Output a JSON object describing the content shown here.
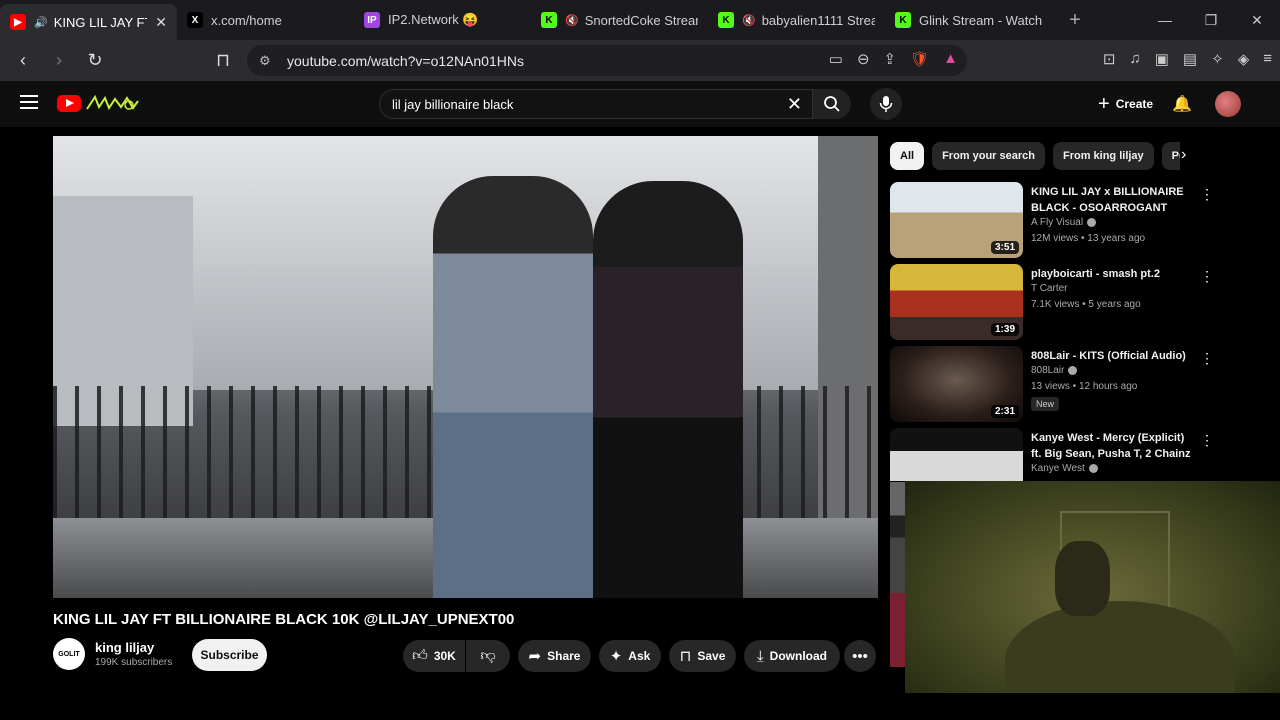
{
  "browser": {
    "tabs": [
      {
        "label": "KING LIL JAY FT B",
        "favicon": "youtube-icon",
        "color": "#ff0000",
        "muted": true,
        "active": true
      },
      {
        "label": "x.com/home",
        "favicon": "x-icon",
        "color": "#000000",
        "muted": false
      },
      {
        "label": "IP2.Network 😝",
        "favicon": "ip2-icon",
        "color": "#a045e0",
        "muted": false
      },
      {
        "label": "SnortedCoke Stream",
        "favicon": "kick-icon",
        "color": "#53fc18",
        "muted": true
      },
      {
        "label": "babyalien1111 Strea",
        "favicon": "kick-icon",
        "color": "#53fc18",
        "muted": true
      },
      {
        "label": "Glink Stream - Watch Li",
        "favicon": "kick-icon",
        "color": "#53fc18",
        "muted": false
      }
    ],
    "url": "youtube.com/watch?v=o12NAn01HNs",
    "badge_count": "99+"
  },
  "youtube": {
    "search_query": "lil jay billionaire black",
    "create_label": "Create",
    "video": {
      "title": "KING LIL JAY FT BILLIONAIRE BLACK 10K @LILJAY_UPNEXT00",
      "channel": "king liljay",
      "subscribers": "199K subscribers",
      "subscribe_label": "Subscribe",
      "likes": "30K",
      "share_label": "Share",
      "ask_label": "Ask",
      "save_label": "Save",
      "download_label": "Download",
      "channel_avatar_text": "GOLIT"
    },
    "chips": [
      "All",
      "From your search",
      "From king liljay",
      "Popular"
    ],
    "recommendations": [
      {
        "title": "KING LIL JAY x BILLIONAIRE BLACK - OSOARROGANT",
        "channel": "A Fly Visual",
        "verified": true,
        "views": "12M views • 13 years ago",
        "duration": "3:51",
        "thumb_color": "#c9b58a"
      },
      {
        "title": "playboicarti - smash pt.2",
        "channel": "T Carter",
        "verified": false,
        "views": "7.1K views • 5 years ago",
        "duration": "1:39",
        "thumb_color": "#c23a1c"
      },
      {
        "title": "808Lair - KITS (Official Audio)",
        "channel": "808Lair",
        "verified": true,
        "views": "13 views • 12 hours ago",
        "duration": "2:31",
        "badge": "New",
        "thumb_color": "#3a2a22"
      },
      {
        "title": "Kanye West - Mercy (Explicit) ft. Big Sean, Pusha T, 2 Chainz",
        "channel": "Kanye West",
        "verified": true,
        "thumb_color": "#d8d8d8"
      }
    ]
  }
}
